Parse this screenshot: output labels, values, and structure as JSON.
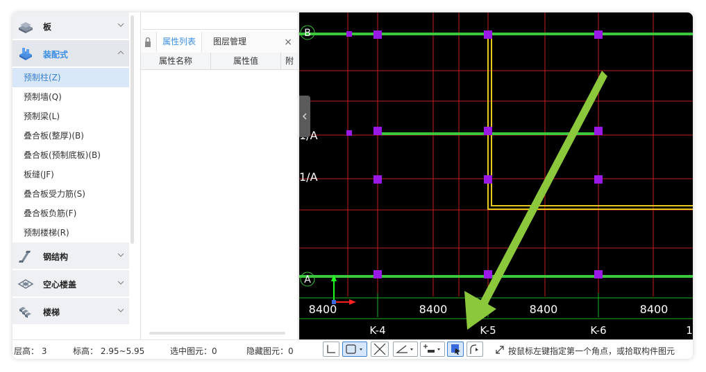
{
  "left_panel": {
    "categories": [
      {
        "label": "板",
        "icon": "slab-icon",
        "expanded": false
      },
      {
        "label": "装配式",
        "icon": "prefab-icon",
        "expanded": true
      },
      {
        "label": "钢结构",
        "icon": "steel-structure-icon",
        "expanded": false
      },
      {
        "label": "空心楼盖",
        "icon": "hollow-floor-icon",
        "expanded": false
      },
      {
        "label": "楼梯",
        "icon": "stair-icon",
        "expanded": false
      }
    ],
    "prefab_items": [
      "预制柱(Z)",
      "预制墙(Q)",
      "预制梁(L)",
      "叠合板(整厚)(B)",
      "叠合板(预制底板)(B)",
      "板缝(JF)",
      "叠合板受力筋(S)",
      "叠合板负筋(F)",
      "预制楼梯(R)"
    ],
    "selected_item": "预制柱(Z)"
  },
  "mid_panel": {
    "tabs": [
      {
        "label": "属性列表",
        "active": true
      },
      {
        "label": "图层管理",
        "active": false
      }
    ],
    "close_glyph": "×",
    "columns": [
      "属性名称",
      "属性值",
      "附"
    ]
  },
  "canvas": {
    "grid_labels": [
      "B",
      "1/A",
      "1/A",
      "A"
    ],
    "dimensions": [
      "8400",
      "8400",
      "8400",
      "8400"
    ],
    "axis_labels": [
      "K-4",
      "K-5",
      "K-6",
      "1"
    ],
    "colors": {
      "background": "#000000",
      "grid_line": "#c81e1e",
      "beam": "#3cc83c",
      "column": "#9b19e6",
      "wall": "#e6c81e",
      "arrow": "#8cc83c",
      "dim_line": "#1eb41e",
      "axis_x": "#ff2020",
      "axis_y": "#20ff20"
    }
  },
  "status_bar": {
    "floor_height": "层高： 3",
    "elevation": "标高： 2.95~5.95",
    "selected": "选中图元：0",
    "hidden": "隐藏图元：0",
    "hint": "按鼠标左键指定第一个角点，或拾取构件图元"
  }
}
